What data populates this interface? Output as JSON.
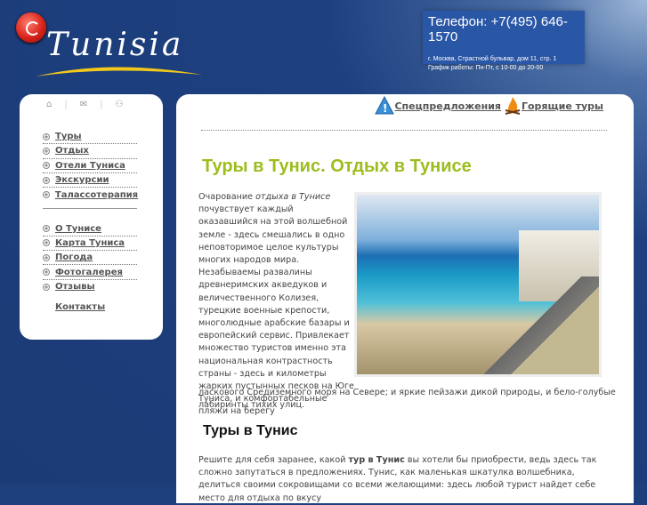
{
  "header": {
    "logo_text": "Tunisia",
    "phone": "Телефон: +7(495) 646-1570",
    "address": "г. Москва, Страстной бульвар, дом 11, стр. 1",
    "hours": "График работы: Пн-Пт, с 10-00 до 20-00"
  },
  "sidebar": {
    "top_icons": [
      "home-icon",
      "mail-icon",
      "sitemap-icon"
    ],
    "menu1": [
      "Туры",
      "Отдых",
      "Отели Туниса",
      "Экскурсии",
      "Талассотерапия"
    ],
    "menu2": [
      "О Тунисе",
      "Карта Туниса",
      "Погода",
      "Фотогалерея",
      "Отзывы"
    ],
    "contacts": "Контакты"
  },
  "top_links": {
    "specials": "Спецпредложения",
    "hot": "Горящие туры"
  },
  "main": {
    "title": "Туры в Тунис. Отдых в Тунисе",
    "p1_start": "Очарование ",
    "p1_em": "отдыха в Тунисе",
    "p1_rest": " почувствует каждый оказавшийся на этой волшебной земле - здесь смешались в одно неповторимое целое культуры многих народов мира. Незабываемы развалины древнеримских акведуков и величественного Колизея, турецкие военные крепости, многолюдные арабские базары и европейский сервис. Привлекает множество туристов именно эта национальная контрастность страны - здесь и километры жарких пустынных песков на Юге Туниса, и комфортабельные пляжи на берегу",
    "p1_end": "ласкового Средиземного моря на Севере; и яркие пейзажи дикой природы, и бело-голубые лабиринты тихих улиц.",
    "h2": "Туры в Тунис",
    "p2_start": "Решите для себя заранее, какой ",
    "p2_bold": "тур в Тунис",
    "p2_rest": " вы хотели бы приобрести, ведь здесь так сложно запутаться в предложениях. Тунис, как маленькая шкатулка волшебника, делиться своими сокровищами со всеми желающими: здесь любой турист найдет себе место для отдыха по вкусу"
  }
}
